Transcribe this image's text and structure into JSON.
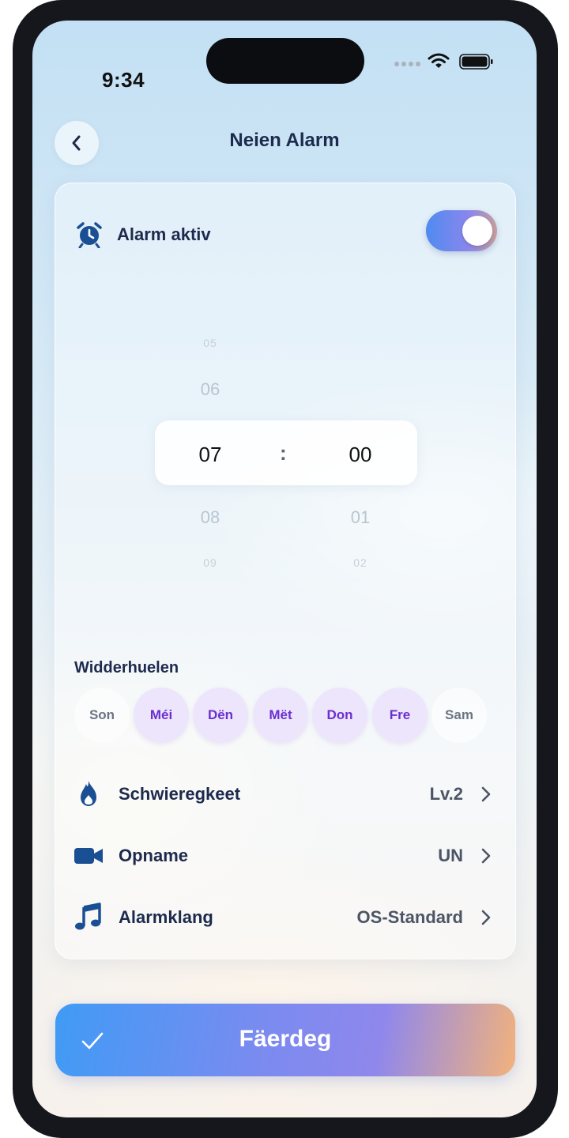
{
  "status_bar": {
    "time": "9:34"
  },
  "header": {
    "title": "Neien Alarm",
    "back_icon": "chevron-left-icon"
  },
  "alarm": {
    "label": "Alarm aktiv",
    "enabled": true,
    "icon": "alarm-clock-icon"
  },
  "time_picker": {
    "hours": {
      "far_above": "05",
      "above": "06",
      "selected": "07",
      "below": "08",
      "far_below": "09"
    },
    "separator": ":",
    "minutes": {
      "selected": "00",
      "below": "01",
      "far_below": "02"
    }
  },
  "repeat": {
    "label": "Widderhuelen",
    "days": [
      {
        "label": "Son",
        "selected": false
      },
      {
        "label": "Méi",
        "selected": true
      },
      {
        "label": "Dën",
        "selected": true
      },
      {
        "label": "Mët",
        "selected": true
      },
      {
        "label": "Don",
        "selected": true
      },
      {
        "label": "Fre",
        "selected": true
      },
      {
        "label": "Sam",
        "selected": false
      }
    ]
  },
  "settings": [
    {
      "label": "Schwieregkeet",
      "value": "Lv.2",
      "icon": "flame-icon"
    },
    {
      "label": "Opname",
      "value": "UN",
      "icon": "video-camera-icon"
    },
    {
      "label": "Alarmklang",
      "value": "OS-Standard",
      "icon": "music-note-icon"
    }
  ],
  "done_button": {
    "label": "Fäerdeg",
    "icon": "checkmark-icon"
  },
  "colors": {
    "text_primary": "#1d2a4d",
    "accent_purple": "#6b2fd0",
    "icon_blue": "#1a4f94"
  }
}
